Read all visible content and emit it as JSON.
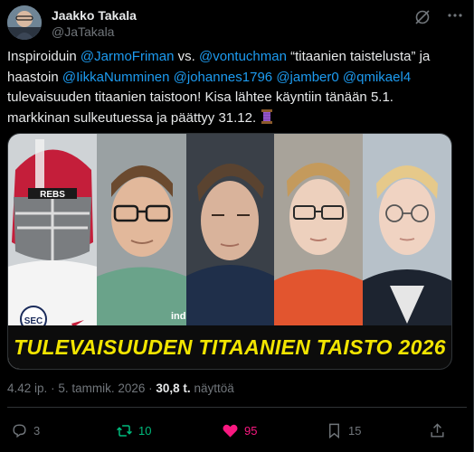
{
  "author": {
    "name": "Jaakko Takala",
    "handle": "@JaTakala"
  },
  "tweet": {
    "segments": [
      {
        "text": "Inspiroiduin ",
        "mention": false
      },
      {
        "text": "@JarmoFriman",
        "mention": true
      },
      {
        "text": " vs. ",
        "mention": false
      },
      {
        "text": "@vontuchman",
        "mention": true
      },
      {
        "text": " “titaanien taistelusta” ja haastoin ",
        "mention": false
      },
      {
        "text": "@IikkaNumminen",
        "mention": true
      },
      {
        "text": " ",
        "mention": false
      },
      {
        "text": "@johannes1796",
        "mention": true
      },
      {
        "text": " ",
        "mention": false
      },
      {
        "text": "@jamber0",
        "mention": true
      },
      {
        "text": " ",
        "mention": false
      },
      {
        "text": "@qmikael4",
        "mention": true
      },
      {
        "text": " tulevaisuuden titaanien taistoon! Kisa lähtee käyntiin tänään 5.1. markkinan sulkeutuessa ja päättyy 31.12. ",
        "mention": false
      }
    ],
    "emoji": "thread-spool-emoji"
  },
  "media": {
    "banner_text": "TULEVAISUUDEN TITAANIEN TAISTO 2026",
    "helmet_text": "REBS",
    "helmet_logo": "SEC",
    "watermark": "inde",
    "banner_color": "#f2e500"
  },
  "meta": {
    "time": "4.42 ip.",
    "separator": "·",
    "date": "5. tammik. 2026",
    "views_count": "30,8 t.",
    "views_label": "näyttöä"
  },
  "actions": {
    "replies": "3",
    "retweets": "10",
    "likes": "95",
    "bookmarks": "15"
  },
  "colors": {
    "background": "#000000",
    "mention": "#1d9bf0",
    "retweet_active": "#00ba7c",
    "like_active": "#f91880",
    "muted": "#71767b"
  }
}
